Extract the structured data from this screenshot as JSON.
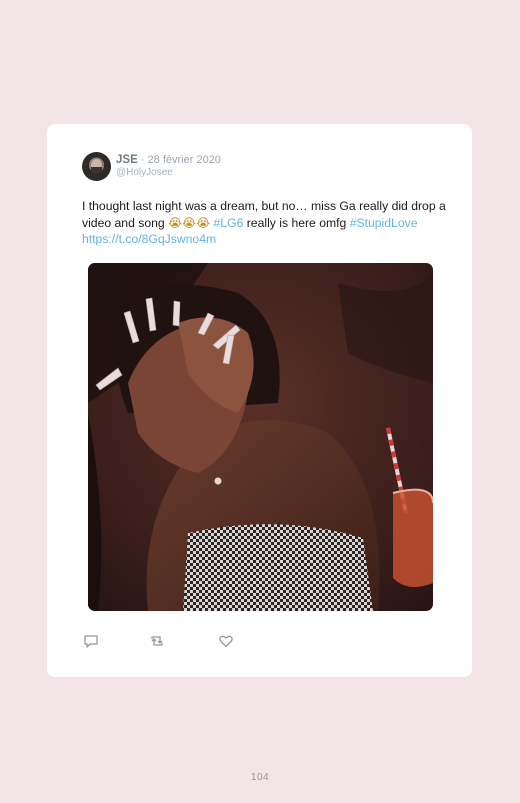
{
  "tweet": {
    "author_name": "JSE",
    "date": "28 février 2020",
    "separator": "·",
    "handle": "@HolyJosee",
    "text_part1": "I thought last night was a dream, but no… miss Ga really did drop a video and song ",
    "emojis": "😭😭😭",
    "hashtag1": "#LG6",
    "text_part2": " really is here omfg ",
    "hashtag2": "#StupidLove",
    "url": "https://t.co/8GqJswno4m"
  },
  "actions": {
    "reply_icon": "reply-icon",
    "retweet_icon": "retweet-icon",
    "like_icon": "heart-icon"
  },
  "colors": {
    "page_background": "#f2e4e7",
    "card_background": "#ffffff",
    "link": "#5fb4e6",
    "icon": "#8e989e"
  },
  "page": {
    "number": "104"
  }
}
